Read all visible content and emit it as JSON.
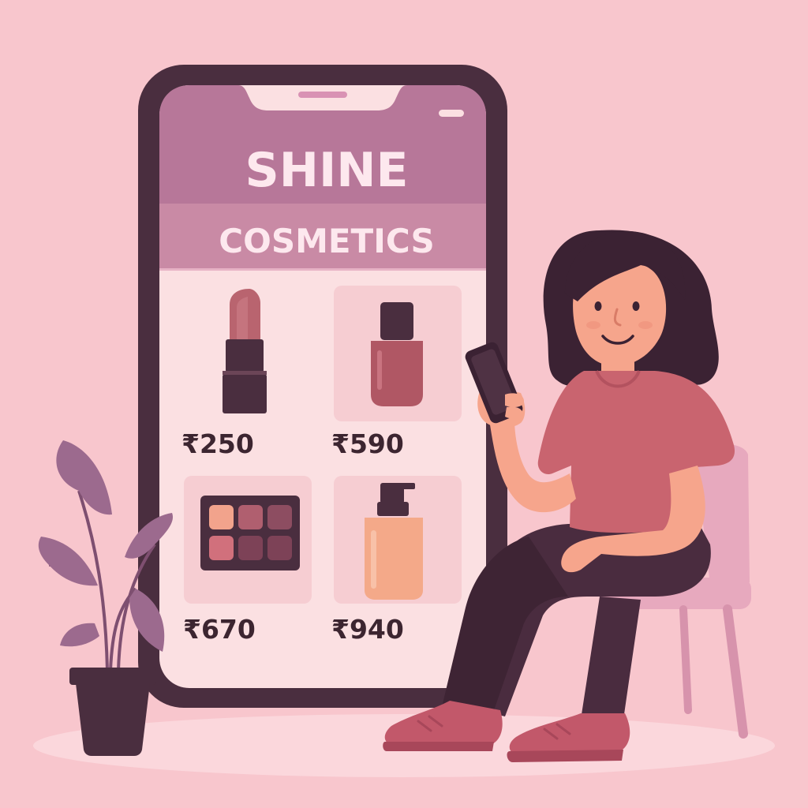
{
  "app": {
    "brand_line1": "SHINE",
    "brand_line2": "COSMETICS"
  },
  "products": [
    {
      "name": "lipstick",
      "price": "₹250",
      "icon": "lipstick-icon"
    },
    {
      "name": "nail-polish",
      "price": "₹590",
      "icon": "nail-polish-icon"
    },
    {
      "name": "eyeshadow-palette",
      "price": "₹670",
      "icon": "eyeshadow-palette-icon"
    },
    {
      "name": "foundation-bottle",
      "price": "₹940",
      "icon": "foundation-bottle-icon"
    }
  ],
  "colors": {
    "background": "#f8c6cd",
    "phone_frame": "#4a2e3f",
    "header_top": "#b77799",
    "header_band": "#c98aa5",
    "screen_body": "#fbe0e2",
    "card_bg": "#f6cdd2",
    "brand_text": "#fde8ee",
    "price_text": "#3c2530",
    "shirt": "#c9646f",
    "pants": "#4a2c3f",
    "skin": "#f6a58c",
    "hair": "#3b2233",
    "shoes": "#c2586a",
    "chair": "#e7a9be",
    "plant_leaf": "#9c6a8e",
    "pot": "#4a2e3f"
  }
}
